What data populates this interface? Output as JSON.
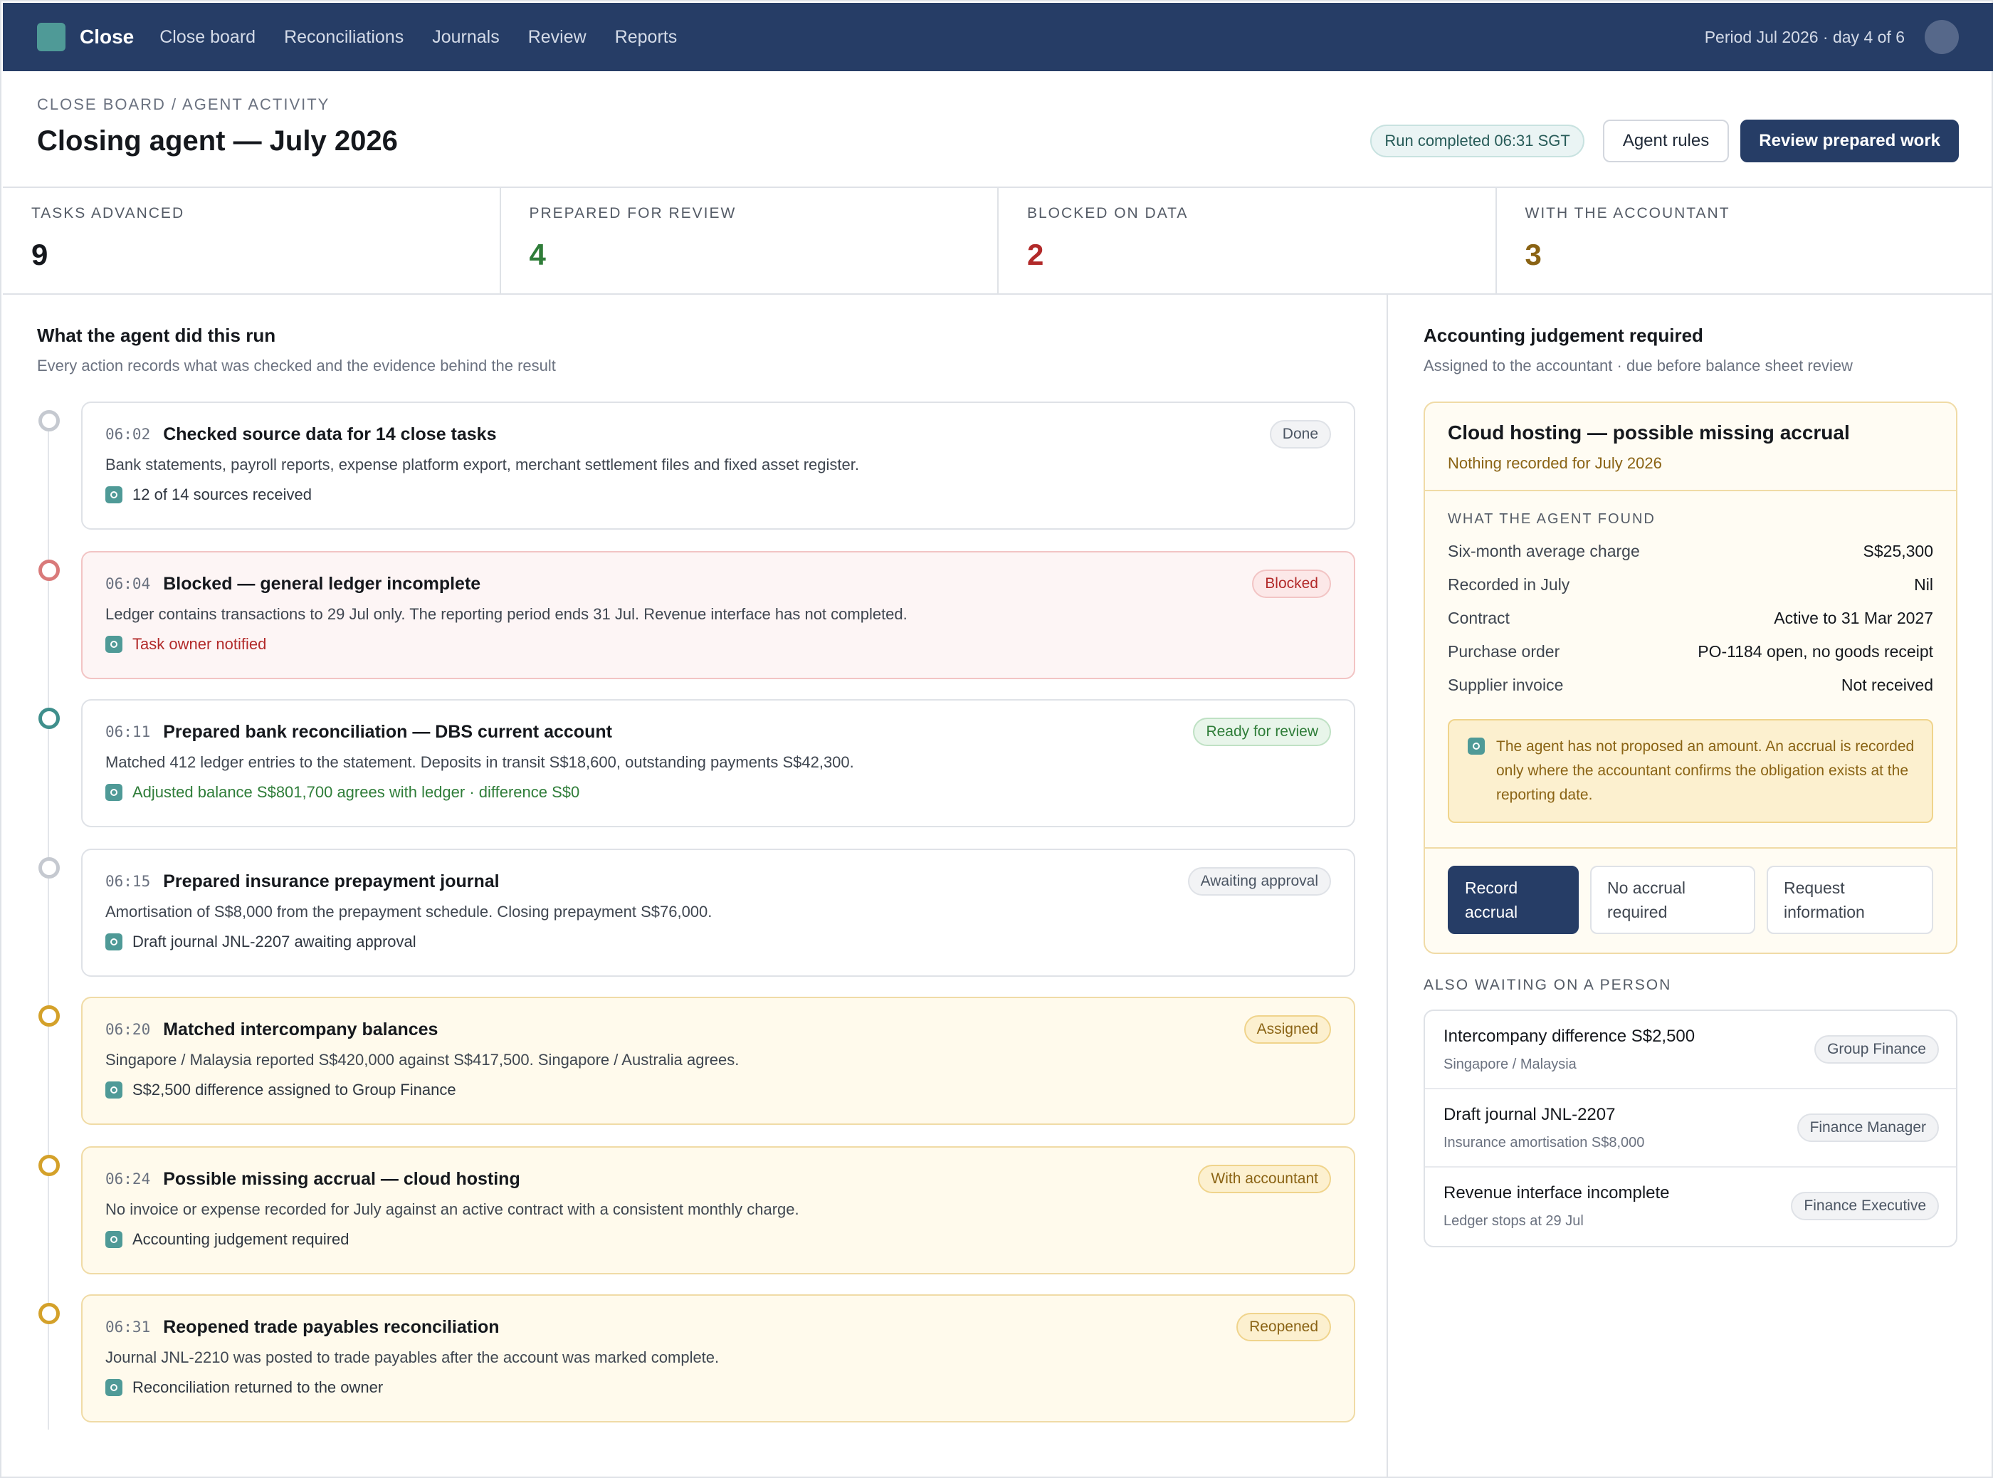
{
  "nav": {
    "brand": "Close",
    "links": [
      "Close board",
      "Reconciliations",
      "Journals",
      "Review",
      "Reports"
    ],
    "period": "Period Jul 2026 · day 4 of 6"
  },
  "header": {
    "breadcrumb": "CLOSE BOARD / AGENT ACTIVITY",
    "title": "Closing agent — July 2026",
    "run_status": "Run completed 06:31 SGT",
    "agent_rules_label": "Agent rules",
    "review_label": "Review prepared work"
  },
  "stats": [
    {
      "label": "TASKS ADVANCED",
      "value": "9",
      "color": "#15181d"
    },
    {
      "label": "PREPARED FOR REVIEW",
      "value": "4",
      "color": "#2f7d39"
    },
    {
      "label": "BLOCKED ON DATA",
      "value": "2",
      "color": "#b22a2a"
    },
    {
      "label": "WITH THE ACCOUNTANT",
      "value": "3",
      "color": "#8a6314"
    }
  ],
  "activity": {
    "title": "What the agent did this run",
    "subtitle": "Every action records what was checked and the evidence behind the result",
    "items": [
      {
        "time": "06:02",
        "title": "Checked source data for 14 close tasks",
        "badge": "Done",
        "desc": "Bank statements, payroll reports, expense platform export, merchant settlement files and fixed asset register.",
        "evidence": "12 of 14 sources received"
      },
      {
        "time": "06:04",
        "title": "Blocked — general ledger incomplete",
        "badge": "Blocked",
        "desc": "Ledger contains transactions to 29 Jul only. The reporting period ends 31 Jul. Revenue interface has not completed.",
        "evidence": "Task owner notified"
      },
      {
        "time": "06:11",
        "title": "Prepared bank reconciliation — DBS current account",
        "badge": "Ready for review",
        "desc": "Matched 412 ledger entries to the statement. Deposits in transit S$18,600, outstanding payments S$42,300.",
        "evidence": "Adjusted balance S$801,700 agrees with ledger · difference S$0"
      },
      {
        "time": "06:15",
        "title": "Prepared insurance prepayment journal",
        "badge": "Awaiting approval",
        "desc": "Amortisation of S$8,000 from the prepayment schedule. Closing prepayment S$76,000.",
        "evidence": "Draft journal JNL-2207 awaiting approval"
      },
      {
        "time": "06:20",
        "title": "Matched intercompany balances",
        "badge": "Assigned",
        "desc": "Singapore / Malaysia reported S$420,000 against S$417,500. Singapore / Australia agrees.",
        "evidence": "S$2,500 difference assigned to Group Finance"
      },
      {
        "time": "06:24",
        "title": "Possible missing accrual — cloud hosting",
        "badge": "With accountant",
        "desc": "No invoice or expense recorded for July against an active contract with a consistent monthly charge.",
        "evidence": "Accounting judgement required"
      },
      {
        "time": "06:31",
        "title": "Reopened trade payables reconciliation",
        "badge": "Reopened",
        "desc": "Journal JNL-2210 was posted to trade payables after the account was marked complete.",
        "evidence": "Reconciliation returned to the owner"
      }
    ]
  },
  "judgement": {
    "title": "Accounting judgement required",
    "subtitle": "Assigned to the accountant · due before balance sheet review",
    "card_title": "Cloud hosting — possible missing accrual",
    "card_sub": "Nothing recorded for July 2026",
    "found_label": "WHAT THE AGENT FOUND",
    "found": [
      {
        "key": "Six-month average charge",
        "value": "S$25,300"
      },
      {
        "key": "Recorded in July",
        "value": "Nil"
      },
      {
        "key": "Contract",
        "value": "Active to 31 Mar 2027"
      },
      {
        "key": "Purchase order",
        "value": "PO-1184 open, no goods receipt"
      },
      {
        "key": "Supplier invoice",
        "value": "Not received"
      }
    ],
    "note": "The agent has not proposed an amount. An accrual is recorded only where the accountant confirms the obligation exists at the reporting date.",
    "actions": [
      "Record accrual",
      "No accrual required",
      "Request information"
    ]
  },
  "waiting": {
    "label": "ALSO WAITING ON A PERSON",
    "items": [
      {
        "title": "Intercompany difference S$2,500",
        "sub": "Singapore / Malaysia",
        "owner": "Group Finance"
      },
      {
        "title": "Draft journal JNL-2207",
        "sub": "Insurance amortisation S$8,000",
        "owner": "Finance Manager"
      },
      {
        "title": "Revenue interface incomplete",
        "sub": "Ledger stops at 29 Jul",
        "owner": "Finance Executive"
      }
    ]
  }
}
